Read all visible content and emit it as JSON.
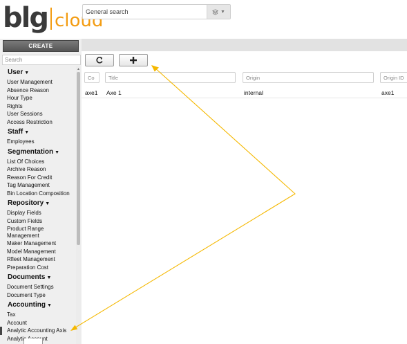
{
  "brand": {
    "logo_main": "blg",
    "logo_sub": "cloud",
    "accent": "#f39c12",
    "dark": "#3a3a3a"
  },
  "header": {
    "search_placeholder": "General search",
    "scope_icon": "layers-icon",
    "scope_caret": "▼"
  },
  "sidebar": {
    "create_label": "CREATE",
    "search_placeholder": "Search",
    "sections": [
      {
        "title": "User",
        "items": [
          "User Management",
          "Absence Reason",
          "Hour Type",
          "Rights",
          "User Sessions",
          "Access Restriction"
        ]
      },
      {
        "title": "Staff",
        "items": [
          "Employees"
        ]
      },
      {
        "title": "Segmentation",
        "items": [
          "List Of Choices",
          "Archive Reason",
          "Reason For Credit",
          "Tag Management",
          "Bin Location Composition"
        ]
      },
      {
        "title": "Repository",
        "items": [
          "Display Fields",
          "Custom Fields",
          "Product Range Management",
          "Maker Management",
          "Model Management",
          "Rfleet Management",
          "Preparation Cost"
        ]
      },
      {
        "title": "Documents",
        "items": [
          "Document Settings",
          "Document Type"
        ]
      },
      {
        "title": "Accounting",
        "items": [
          "Tax",
          "Account",
          "Analytic Accounting Axis",
          "Analytic Account"
        ]
      }
    ],
    "active_item": "Analytic Accounting Axis"
  },
  "toolbar": {
    "refresh_icon": "refresh-icon",
    "add_icon": "plus-icon"
  },
  "filters": {
    "code_placeholder": "Co",
    "title_placeholder": "Title",
    "origin_placeholder": "Origin",
    "origin_id_placeholder": "Origin ID"
  },
  "rows": [
    {
      "code": "axe1",
      "title": "Axe 1",
      "origin": "internal",
      "origin_id": "axe1"
    }
  ],
  "annotation": {
    "color": "#f5b800"
  }
}
